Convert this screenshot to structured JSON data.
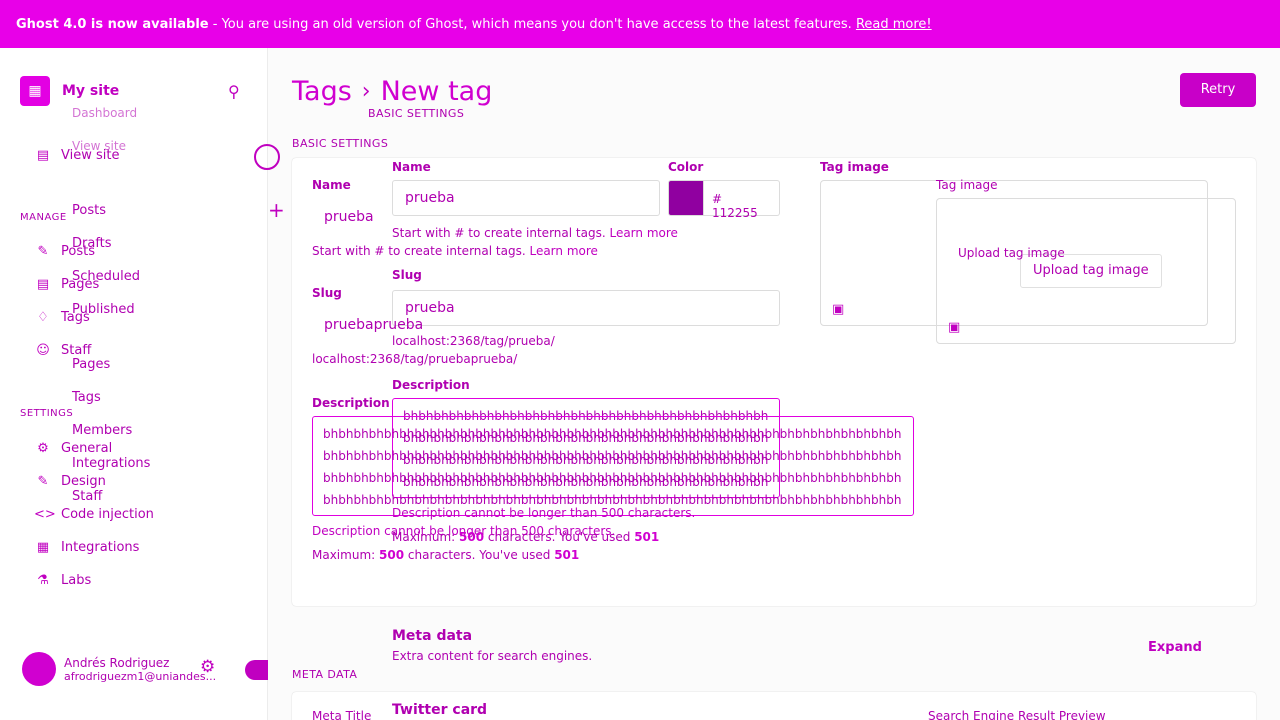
{
  "banner": {
    "strong": "Ghost 4.0 is now available",
    "text": " - You are using an old version of Ghost, which means you don't have access to the latest features. ",
    "link": "Read more!"
  },
  "sidebar": {
    "site_logo_glyph": "▦",
    "site_name": "My site",
    "top_items": [
      {
        "label": "Dashboard",
        "icon": "dashboard-icon"
      },
      {
        "label": "View site",
        "icon": "view-site-icon"
      }
    ],
    "manage_label": "MANAGE",
    "manage_items": [
      {
        "label": "Posts",
        "icon": "posts-icon"
      },
      {
        "label": "Pages",
        "icon": "pages-icon"
      },
      {
        "label": "Tags",
        "icon": "tags-icon"
      },
      {
        "label": "Staff",
        "icon": "staff-icon"
      }
    ],
    "post_subitems": [
      "Drafts",
      "Scheduled",
      "Published"
    ],
    "secondary_items": [
      "Pages",
      "Tags",
      "Members",
      "Integrations",
      "Staff"
    ],
    "settings_label": "SETTINGS",
    "settings_items": [
      {
        "label": "General",
        "icon": "general-icon"
      },
      {
        "label": "Design",
        "icon": "design-icon"
      },
      {
        "label": "Code injection",
        "icon": "code-icon"
      },
      {
        "label": "Integrations",
        "icon": "integrations-icon"
      },
      {
        "label": "Labs",
        "icon": "labs-icon"
      }
    ],
    "user": {
      "name": "Andrés Rodriguez",
      "email": "afrodriguezm1@uniandes..."
    }
  },
  "main": {
    "breadcrumb_parent": "Tags",
    "breadcrumb_current": "New tag",
    "retry_label": "Retry",
    "basic_settings_label": "BASIC SETTINGS",
    "basic_settings_label_2": "BASIC SETTINGS",
    "name_label": "Name",
    "name_value": "prueba",
    "name_label_2": "Name",
    "name_value_2": "prueba",
    "name_hint": "Start with # to create internal tags.",
    "name_hint_link": "Learn more",
    "color_label": "Color",
    "color_value": "# 112255",
    "slug_label": "Slug",
    "slug_value": "prueba",
    "slug_label_2": "Slug",
    "slug_value_2": "pruebaprueba",
    "slug_url": "localhost:2368/tag/prueba/",
    "slug_url_2": "localhost:2368/tag/pruebaprueba/",
    "description_label": "Description",
    "description_label_2": "Description",
    "description_text": "bhbhbhbhbhbhbhbhbhbhbhbhbhbhbhbhbhbhbhbhbhbhbhbhbhbhbhbhbhbhbhbhbhbhbhbhbhbhbhbhbhbhbhbhbhbhbhbhbhbhbhbhbhbhbhbhbhbhbhbhbhbhbhbhbhbhbhbhbhbhbhbhbhbhbhbhbhbhbhbhbhbhbhbhbhbhbhbhbhbhbhbhbhbhbhbhbhbhbhbhbhbhbhbhbhbhbhbhbhbhbhbhbhbhbhbhbhbhbhbhbhbhbhbhbhbhbhbhbhbhbhbhbhbhbhbhbhbhbhbhbhbhbhbhbhbhbhbhbhbhbhbhbh bhbhk hbkghbkbnkj hbkhbkhbhbbkjkhbkjkbhbk bc",
    "description_error": "Description cannot be longer than 500 characters.",
    "description_error_2": "Description cannot be longer than 500 characters.",
    "count_prefix": "Maximum:",
    "count_max": "500",
    "count_middle": "characters. You've used",
    "count_used": "501",
    "tag_image_label": "Tag image",
    "tag_image_label_2": "Tag image",
    "upload_label": "Upload tag image",
    "upload_label_2": "Upload tag image",
    "meta_title": "Meta data",
    "meta_sub": "Extra content for search engines.",
    "expand_label": "Expand",
    "meta_data_label": "META DATA",
    "meta_field_label": "Meta Title",
    "twitter_title": "Twitter card",
    "seo_preview": "Search Engine Result Preview"
  }
}
